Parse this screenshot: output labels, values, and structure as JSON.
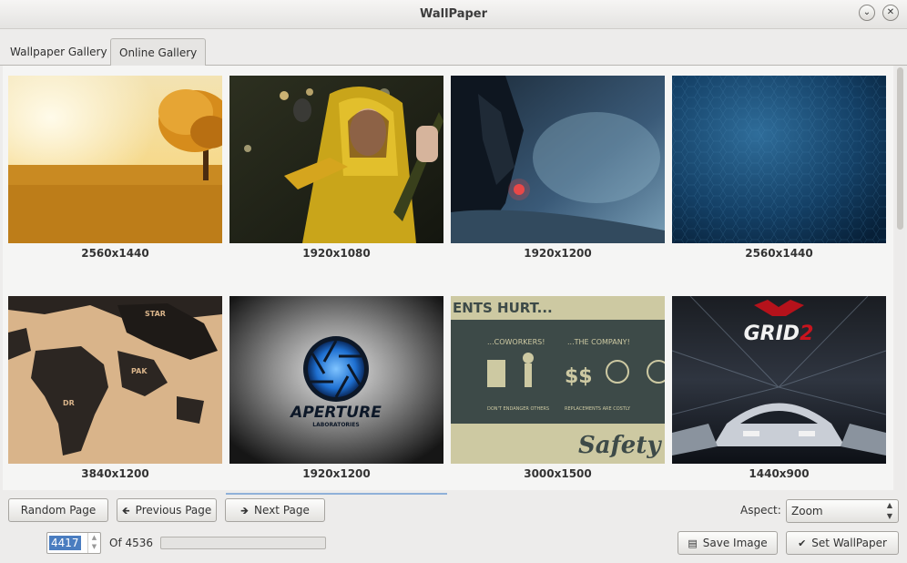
{
  "window": {
    "title": "WallPaper"
  },
  "tabs": [
    {
      "label": "Wallpaper Gallery"
    },
    {
      "label": "Online Gallery"
    }
  ],
  "gallery": {
    "items": [
      {
        "resolution": "2560x1440",
        "scene": "golden-field-tree"
      },
      {
        "resolution": "1920x1080",
        "scene": "girl-yellow-raincoat"
      },
      {
        "resolution": "1920x1200",
        "scene": "robot-cyborg-dark"
      },
      {
        "resolution": "2560x1440",
        "scene": "blue-hexagon-pattern"
      },
      {
        "resolution": "3840x1200",
        "scene": "typographic-world-map"
      },
      {
        "resolution": "1920x1200",
        "scene": "aperture-laboratories-logo"
      },
      {
        "resolution": "3000x1500",
        "scene": "safety-poster"
      },
      {
        "resolution": "1440x900",
        "scene": "grid-2-racing"
      }
    ],
    "poster_text": {
      "header": "ENTS HURT...",
      "coworkers": "...COWORKERS!",
      "company": "...THE COMPANY!",
      "dont_endanger": "DON'T ENDANGER OTHERS",
      "replacements": "REPLACEMENTS ARE COSTLY",
      "safety": "Safety"
    },
    "aperture_text": {
      "name": "APERTURE",
      "sub": "LABORATORIES"
    },
    "grid_text": {
      "title": "GRID",
      "num": "2"
    }
  },
  "controls": {
    "random_page": "Random Page",
    "previous_page": "Previous Page",
    "next_page": "Next Page",
    "aspect_label": "Aspect:",
    "aspect_value": "Zoom",
    "page_value": "4417",
    "page_total": "Of 4536",
    "save_image": "Save Image",
    "set_wallpaper": "Set WallPaper"
  },
  "colors": {
    "window_bg": "#edeceb",
    "selection": "#4a7dc0"
  }
}
